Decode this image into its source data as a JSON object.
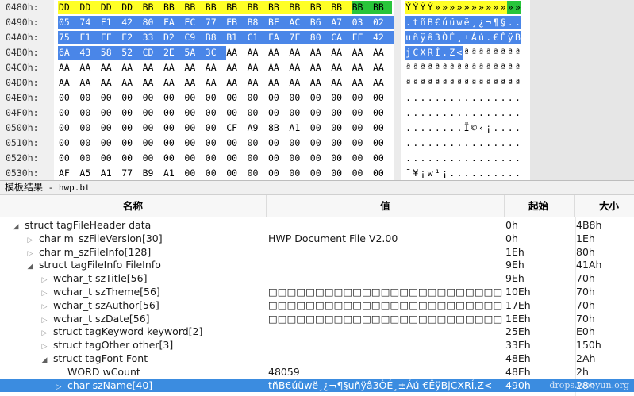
{
  "hex": {
    "rows": [
      {
        "addr": "0480h:",
        "bytes": [
          "DD",
          "DD",
          "DD",
          "DD",
          "BB",
          "BB",
          "BB",
          "BB",
          "BB",
          "BB",
          "BB",
          "BB",
          "BB",
          "BB",
          "BB",
          "BB"
        ],
        "ascii": "ÝÝÝÝ»»»»»»»»»»»»"
      },
      {
        "addr": "0490h:",
        "bytes": [
          "05",
          "74",
          "F1",
          "42",
          "80",
          "FA",
          "FC",
          "77",
          "EB",
          "B8",
          "BF",
          "AC",
          "B6",
          "A7",
          "03",
          "02"
        ],
        "ascii": ".tñB€úüwë¸¿¬¶§.."
      },
      {
        "addr": "04A0h:",
        "bytes": [
          "75",
          "F1",
          "FF",
          "E2",
          "33",
          "D2",
          "C9",
          "B8",
          "B1",
          "C1",
          "FA",
          "7F",
          "80",
          "CA",
          "FF",
          "42"
        ],
        "ascii": "uñÿâ3ÒÉ¸±Áú.€ÊÿB"
      },
      {
        "addr": "04B0h:",
        "bytes": [
          "6A",
          "43",
          "58",
          "52",
          "CD",
          "2E",
          "5A",
          "3C",
          "AA",
          "AA",
          "AA",
          "AA",
          "AA",
          "AA",
          "AA",
          "AA"
        ],
        "ascii": "jCXRÍ.Z<ªªªªªªªª"
      },
      {
        "addr": "04C0h:",
        "bytes": [
          "AA",
          "AA",
          "AA",
          "AA",
          "AA",
          "AA",
          "AA",
          "AA",
          "AA",
          "AA",
          "AA",
          "AA",
          "AA",
          "AA",
          "AA",
          "AA"
        ],
        "ascii": "ªªªªªªªªªªªªªªªª"
      },
      {
        "addr": "04D0h:",
        "bytes": [
          "AA",
          "AA",
          "AA",
          "AA",
          "AA",
          "AA",
          "AA",
          "AA",
          "AA",
          "AA",
          "AA",
          "AA",
          "AA",
          "AA",
          "AA",
          "AA"
        ],
        "ascii": "ªªªªªªªªªªªªªªªª"
      },
      {
        "addr": "04E0h:",
        "bytes": [
          "00",
          "00",
          "00",
          "00",
          "00",
          "00",
          "00",
          "00",
          "00",
          "00",
          "00",
          "00",
          "00",
          "00",
          "00",
          "00"
        ],
        "ascii": "................"
      },
      {
        "addr": "04F0h:",
        "bytes": [
          "00",
          "00",
          "00",
          "00",
          "00",
          "00",
          "00",
          "00",
          "00",
          "00",
          "00",
          "00",
          "00",
          "00",
          "00",
          "00"
        ],
        "ascii": "................"
      },
      {
        "addr": "0500h:",
        "bytes": [
          "00",
          "00",
          "00",
          "00",
          "00",
          "00",
          "00",
          "00",
          "CF",
          "A9",
          "8B",
          "A1",
          "00",
          "00",
          "00",
          "00"
        ],
        "ascii": "........Ï©‹¡...."
      },
      {
        "addr": "0510h:",
        "bytes": [
          "00",
          "00",
          "00",
          "00",
          "00",
          "00",
          "00",
          "00",
          "00",
          "00",
          "00",
          "00",
          "00",
          "00",
          "00",
          "00"
        ],
        "ascii": "................"
      },
      {
        "addr": "0520h:",
        "bytes": [
          "00",
          "00",
          "00",
          "00",
          "00",
          "00",
          "00",
          "00",
          "00",
          "00",
          "00",
          "00",
          "00",
          "00",
          "00",
          "00"
        ],
        "ascii": "................"
      },
      {
        "addr": "0530h:",
        "bytes": [
          "AF",
          "A5",
          "A1",
          "77",
          "B9",
          "A1",
          "00",
          "00",
          "00",
          "00",
          "00",
          "00",
          "00",
          "00",
          "00",
          "00"
        ],
        "ascii": "¯¥¡w¹¡.........."
      }
    ]
  },
  "panel": {
    "title": "模板结果",
    "file": " - hwp.bt"
  },
  "columns": {
    "name": "名称",
    "value": "值",
    "start": "起始",
    "size": "大小"
  },
  "tree": [
    {
      "indent": 0,
      "toggle": "open",
      "name": "struct tagFileHeader data",
      "value": "",
      "start": "0h",
      "size": "4B8h"
    },
    {
      "indent": 1,
      "toggle": "closed",
      "name": "char m_szFileVersion[30]",
      "value": "HWP Document File V2.00",
      "start": "0h",
      "size": "1Eh"
    },
    {
      "indent": 1,
      "toggle": "closed",
      "name": "char m_szFileInfo[128]",
      "value": "",
      "start": "1Eh",
      "size": "80h"
    },
    {
      "indent": 1,
      "toggle": "open",
      "name": "struct tagFileInfo FileInfo",
      "value": "",
      "start": "9Eh",
      "size": "41Ah"
    },
    {
      "indent": 2,
      "toggle": "closed",
      "name": "wchar_t szTitle[56]",
      "value": "",
      "start": "9Eh",
      "size": "70h"
    },
    {
      "indent": 2,
      "toggle": "closed",
      "name": "wchar_t szTheme[56]",
      "value": "□□□□□□□□□□□□□□□□□□□□□□□□□□□□□□□□□□□□",
      "start": "10Eh",
      "size": "70h"
    },
    {
      "indent": 2,
      "toggle": "closed",
      "name": "wchar_t szAuthor[56]",
      "value": "□□□□□□□□□□□□□□□□□□□□□□□□□□□□□□□□□□□□",
      "start": "17Eh",
      "size": "70h"
    },
    {
      "indent": 2,
      "toggle": "closed",
      "name": "wchar_t szDate[56]",
      "value": "□□□□□□□□□□□□□□□□□□□□□□□□□□□□□□□□□□□□",
      "start": "1EEh",
      "size": "70h"
    },
    {
      "indent": 2,
      "toggle": "closed",
      "name": "struct tagKeyword keyword[2]",
      "value": "",
      "start": "25Eh",
      "size": "E0h"
    },
    {
      "indent": 2,
      "toggle": "closed",
      "name": "struct tagOther other[3]",
      "value": "",
      "start": "33Eh",
      "size": "150h"
    },
    {
      "indent": 2,
      "toggle": "open",
      "name": "struct tagFont Font",
      "value": "",
      "start": "48Eh",
      "size": "2Ah"
    },
    {
      "indent": 3,
      "toggle": "none",
      "name": "WORD wCount",
      "value": "48059",
      "start": "48Eh",
      "size": "2h"
    },
    {
      "indent": 3,
      "toggle": "closed",
      "name": "char szName[40]",
      "value": "tñB€úüwë¸¿¬¶§uñÿâ3ÒÉ¸±Áú €ÊÿBjCXRÍ.Z<",
      "start": "490h",
      "size": "28h",
      "selected": true
    }
  ],
  "watermark": "drops.wooyun.org",
  "colors": {
    "highlight_yellow": "#ffff26",
    "highlight_green": "#28c53a",
    "highlight_blue": "#4a86e8",
    "selected_row": "#3b8ce0"
  }
}
